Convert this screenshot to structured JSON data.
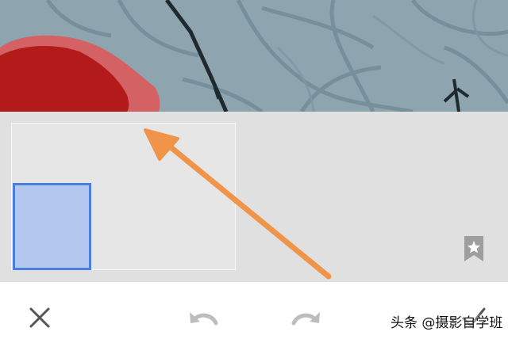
{
  "photo": {
    "description_icon": "photo-background",
    "colors": {
      "sky": "#8ba2ad",
      "branch": "#1f2a2f",
      "flower": "#b31b1b",
      "mask": "#e25050"
    }
  },
  "panel": {
    "background": "#e0e0e0",
    "selection_color": "#4a7fe0",
    "arrow_color": "#f0944a"
  },
  "bookmark": {
    "icon": "bookmark-star-icon"
  },
  "toolbar": {
    "close_icon": "close-icon",
    "undo_icon": "undo-icon",
    "redo_icon": "redo-icon",
    "apply_icon": "checkmark-icon"
  },
  "watermark": {
    "text": "头条 @摄影自学班"
  }
}
